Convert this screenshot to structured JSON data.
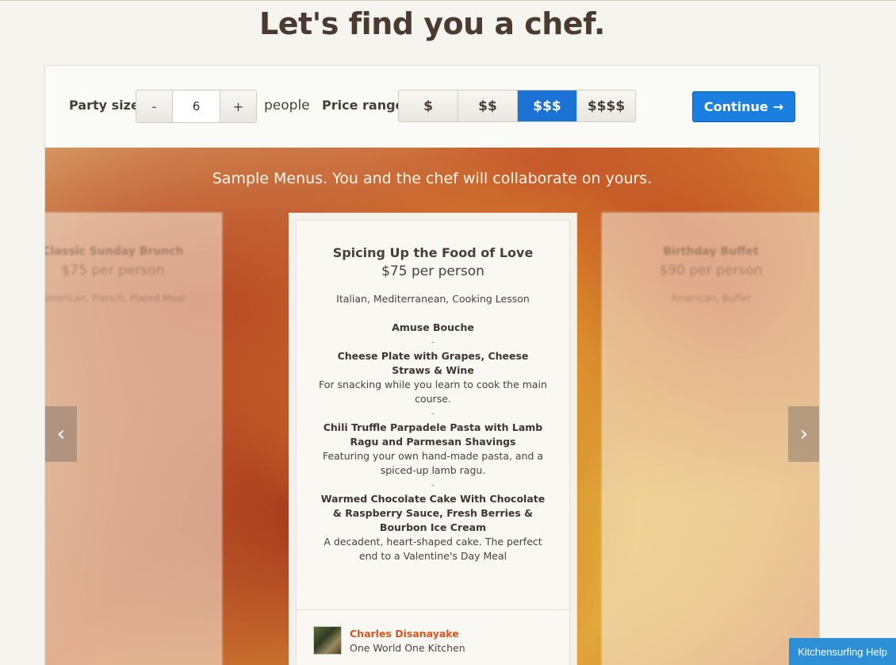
{
  "title": "Let's find you a chef.",
  "controls": {
    "party_size_label": "Party size",
    "minus": "-",
    "party_size_value": "6",
    "plus": "+",
    "people_label": "people",
    "price_range_label": "Price range",
    "price_options": [
      "$",
      "$$",
      "$$$",
      "$$$$"
    ],
    "price_selected": "$$$",
    "continue_label": "Continue",
    "continue_arrow": "→"
  },
  "hero": {
    "caption": "Sample Menus. You and the chef will collaborate on yours.",
    "prev_arrow": "‹",
    "next_arrow": "›"
  },
  "left_menu": {
    "title": "Classic Sunday Brunch",
    "price": "$75 per person",
    "tags": "American, French, Plated Meal"
  },
  "right_menu": {
    "title": "Birthday Buffet",
    "price": "$90 per person",
    "tags": "American, Buffet"
  },
  "menu": {
    "title": "Spicing Up the Food of Love",
    "price": "$75 per person",
    "tags": "Italian, Mediterranean, Cooking Lesson",
    "courses": [
      {
        "name": "Amuse Bouche",
        "desc": ""
      },
      {
        "name": "Cheese Plate with Grapes, Cheese Straws & Wine",
        "desc": "For snacking while you learn to cook the main course."
      },
      {
        "name": "Chili Truffle Parpadele Pasta with Lamb Ragu and Parmesan Shavings",
        "desc": "Featuring your own hand-made pasta, and a spiced-up lamb ragu."
      },
      {
        "name": "Warmed Chocolate Cake With Chocolate & Raspberry Sauce, Fresh Berries & Bourbon Ice Cream",
        "desc": "A decadent, heart-shaped cake. The perfect end to a Valentine's Day Meal"
      }
    ],
    "separator": "-",
    "chef_name": "Charles Disanayake",
    "chef_company": "One World One Kitchen"
  },
  "help_label": "Kitchensurfing Help",
  "colors": {
    "accent": "#1a73d4",
    "chef_link": "#d9531e"
  }
}
